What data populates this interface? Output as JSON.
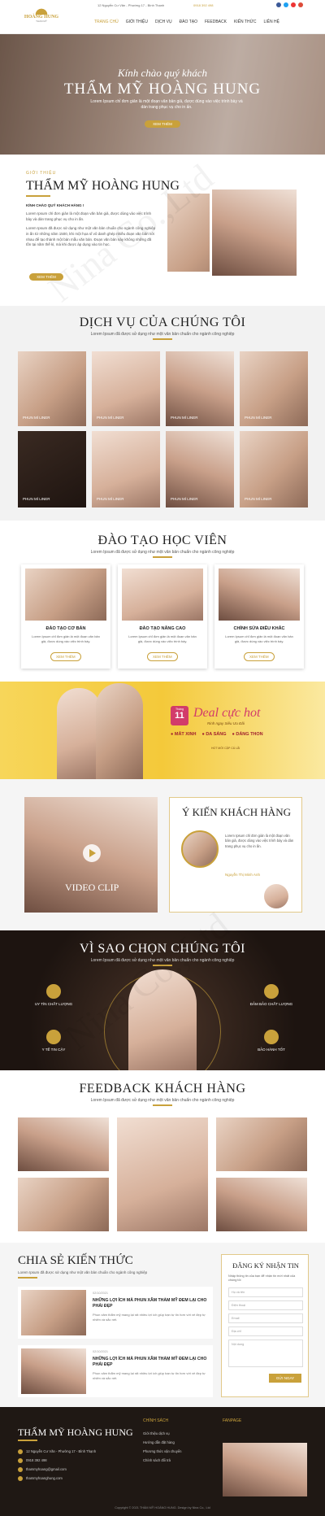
{
  "brand": {
    "name": "HOÀNG HUNG",
    "tagline": "THẨM MỸ",
    "colors": {
      "gold": "#c9a13b",
      "dark": "#2a1d16",
      "yellow": "#f4c93a"
    }
  },
  "topbar": {
    "address": "12 Nguyễn Cư Văn - Phường 17 - Bình Thạnh",
    "phone": "0918 392 498"
  },
  "nav": [
    {
      "label": "TRANG CHỦ"
    },
    {
      "label": "GIỚI THIỆU"
    },
    {
      "label": "DỊCH VỤ"
    },
    {
      "label": "ĐÀO TẠO"
    },
    {
      "label": "FEEDBACK"
    },
    {
      "label": "KIẾN THỨC"
    },
    {
      "label": "LIÊN HỆ"
    }
  ],
  "hero": {
    "script": "Kính chào quý khách",
    "title": "THẨM MỸ HOÀNG HUNG",
    "text": "Lorem Ipsum chỉ đơn giản là một đoạn văn bản giả, được dùng vào việc trình bày và dàn trang phục vụ cho in ấn.",
    "button": "XEM THÊM"
  },
  "about": {
    "kicker": "GIỚI THIỆU",
    "title": "THẨM MỸ HOÀNG HUNG",
    "greeting": "KÍNH CHÀO QUÝ KHÁCH HÀNG !",
    "p1": "Lorem Ipsum chỉ đơn giản là một đoạn văn bản giả, được dùng vào việc trình bày và dàn trang phục vụ cho in ấn.",
    "p2": "Lorem Ipsum đã được sử dụng như một văn bản chuẩn cho ngành công nghiệp in ấn từ những năm 1500, khi một họa sĩ vô danh ghép nhiều đoạn văn bản với nhau để tạo thành một bản mẫu văn bản. Đoạn văn bản này không những đã tồn tại năm thế kỉ, mà khi được áp dụng vào tin học.",
    "button": "XEM THÊM"
  },
  "services": {
    "title": "DỊCH VỤ CỦA CHÚNG TÔI",
    "subtitle": "Lorem Ipsum đã được sử dụng như một văn bản chuẩn cho ngành công nghiệp",
    "items": [
      {
        "label": "PHUN MÍ LINER"
      },
      {
        "label": "PHUN MÍ LINER"
      },
      {
        "label": "PHUN MÍ LINER"
      },
      {
        "label": "PHUN MÍ LINER"
      },
      {
        "label": "PHUN MÍ LINER"
      },
      {
        "label": "PHUN MÍ LINER"
      },
      {
        "label": "PHUN MÍ LINER"
      },
      {
        "label": "PHUN MÍ LINER"
      }
    ]
  },
  "training": {
    "title": "ĐÀO TẠO HỌC VIÊN",
    "subtitle": "Lorem Ipsum đã được sử dụng như một văn bản chuẩn cho ngành công nghiệp",
    "courses": [
      {
        "title": "ĐÀO TẠO CƠ BẢN",
        "text": "Lorem Ipsum chỉ đơn giản là một đoạn văn bản giả, được dùng vào việc trình bày.",
        "button": "XEM THÊM"
      },
      {
        "title": "ĐÀO TẠO NÂNG CAO",
        "text": "Lorem Ipsum chỉ đơn giản là một đoạn văn bản giả, được dùng vào việc trình bày.",
        "button": "XEM THÊM"
      },
      {
        "title": "CHỈNH SỬA ĐIÊU KHẮC",
        "text": "Lorem Ipsum chỉ đơn giản là một đoạn văn bản giả, được dùng vào việc trình bày.",
        "button": "XEM THÊM"
      }
    ]
  },
  "promo": {
    "month_label": "Tháng",
    "month": "11",
    "title": "Deal cực hot",
    "subtitle": "Rinh ngay Siêu Ưu Đãi",
    "items": [
      "MẮT XINH",
      "DA SÁNG",
      "DÁNG THON"
    ],
    "footnote": "HOT MỚI CẬP CÁ LÃI"
  },
  "video": {
    "label": "VIDEO CLIP"
  },
  "opinion": {
    "title": "Ý KIẾN KHÁCH HÀNG",
    "text": "Lorem Ipsum chỉ đơn giản là một đoạn văn bản giả, được dùng vào việc trình bày và dàn trang phục vụ cho in ấn.",
    "name": "Nguyễn Thị Minh Anh"
  },
  "why": {
    "title": "VÌ SAO CHỌN CHÚNG TÔI",
    "subtitle": "Lorem Ipsum đã được sử dụng như một văn bản chuẩn cho ngành công nghiệp",
    "left": [
      "UY TÍN CHẤT LƯỢNG",
      "Y TẾ TIN CẬY"
    ],
    "right": [
      "ĐẢM BẢO CHẤT LƯỢNG",
      "BẢO HÀNH TỐT"
    ]
  },
  "feedback": {
    "title": "FEEDBACK KHÁCH HÀNG",
    "subtitle": "Lorem Ipsum đã được sử dụng như một văn bản chuẩn cho ngành công nghiệp"
  },
  "knowledge": {
    "title": "CHIA SẺ KIẾN THỨC",
    "subtitle": "Lorem Ipsum đã được sử dụng như một văn bản chuẩn cho ngành công nghiệp",
    "posts": [
      {
        "date": "02/10/2021",
        "title": "NHỮNG LỢI ÍCH MÀ PHUN XĂM THẨM MỸ ĐEM LẠI CHO PHÁI ĐẸP",
        "text": "Phun xăm thẩm mỹ mang lại rất nhiều lợi ích giúp bạn tự tin hơn với vẻ đẹp tự nhiên và sắc nét."
      },
      {
        "date": "02/10/2021",
        "title": "NHỮNG LỢI ÍCH MÀ PHUN XĂM THẨM MỸ ĐEM LẠI CHO PHÁI ĐẸP",
        "text": "Phun xăm thẩm mỹ mang lại rất nhiều lợi ích giúp bạn tự tin hơn với vẻ đẹp tự nhiên và sắc nét."
      }
    ]
  },
  "subscribe": {
    "title": "ĐĂNG KÝ NHẬN TIN",
    "text": "Nhập thông tin của bạn để nhận tin mới nhất của chúng tôi",
    "fields": [
      "Họ và tên",
      "Điện thoại",
      "Email",
      "Địa chỉ",
      "Nội dung"
    ],
    "button": "GỬI NGAY"
  },
  "footer": {
    "title": "THẨM MỸ HOÀNG HUNG",
    "address": "12 Nguyễn Cư Văn - Phường 17 - Bình Thạnh",
    "phone": "0918 392 498",
    "email": "thammyhoang@gmail.com",
    "web": "thammyhoanghung.com",
    "policy_title": "CHÍNH SÁCH",
    "policies": [
      "Giới thiệu dịch vụ",
      "Hướng dẫn đặt hàng",
      "Phương thức vận chuyển",
      "Chính sách đổi trả"
    ],
    "fanpage_title": "FANPAGE",
    "copyright": "Copyright © 2021 THẨM MỸ HOÀNG HUNG. Design by Nina Co., Ltd"
  }
}
